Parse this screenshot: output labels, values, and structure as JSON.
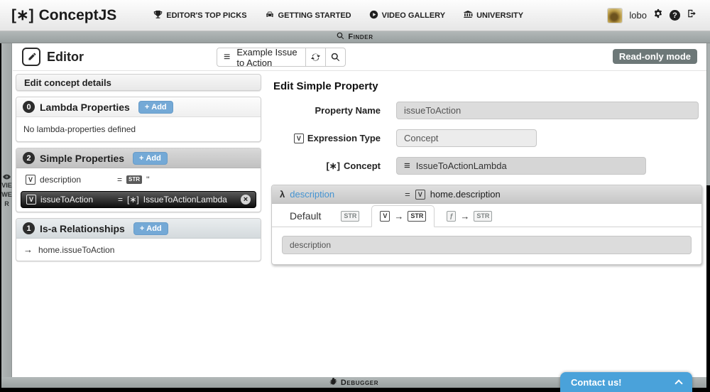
{
  "navbar": {
    "logo_symbol": "[∗]",
    "logo_name": "ConceptJS",
    "items": [
      {
        "label": "EDITOR'S TOP PICKS"
      },
      {
        "label": "GETTING STARTED"
      },
      {
        "label": "VIDEO GALLERY"
      },
      {
        "label": "UNIVERSITY"
      }
    ],
    "username": "lobo"
  },
  "finder_bar": {
    "label": "Finder"
  },
  "toolbar": {
    "editor_title": "Editor",
    "concept_name": "Example Issue to Action",
    "readonly_label": "Read-only mode"
  },
  "viewer_panel": {
    "label": "VIEWER"
  },
  "sidebar": {
    "header": "Edit concept details",
    "lambda": {
      "count": "0",
      "title": "Lambda Properties",
      "add_label": "Add",
      "empty_message": "No lambda-properties defined"
    },
    "simple": {
      "count": "2",
      "title": "Simple Properties",
      "add_label": "Add",
      "rows": [
        {
          "badge": "V",
          "name": "description",
          "eq": "=",
          "type": "STR",
          "value": "''"
        },
        {
          "badge": "V",
          "name": "issueToAction",
          "eq": "=",
          "type": "[∗]",
          "value": "IssueToActionLambda"
        }
      ]
    },
    "isa": {
      "count": "1",
      "title": "Is-a Relationships",
      "add_label": "Add",
      "rows": [
        {
          "value": "home.issueToAction"
        }
      ]
    }
  },
  "editor": {
    "title": "Edit Simple Property",
    "property_name": {
      "label": "Property Name",
      "value": "issueToAction"
    },
    "expression_type": {
      "badge": "V",
      "label": "Expression Type",
      "value": "Concept"
    },
    "concept": {
      "badge": "[∗]",
      "label": "Concept",
      "value": "IssueToActionLambda"
    },
    "expression": {
      "name": "description",
      "eq": "=",
      "badge": "V",
      "binding": "home.description",
      "tabs": {
        "default_label": "Default",
        "str_badge": "STR",
        "v_badge": "V",
        "v_str_badge": "STR",
        "script_str_badge": "STR"
      },
      "value": "description"
    }
  },
  "debugger_bar": {
    "label": "Debugger"
  },
  "contact": {
    "label": "Contact us!"
  },
  "icons": {
    "menu": "≡",
    "lambda": "λ",
    "arrow_right": "→",
    "remove": "×",
    "plus": "+",
    "script": "ƒ"
  },
  "colors": {
    "accent_blue": "#74a9d6",
    "link_blue": "#4493d1",
    "readonly_gray": "#6d7878",
    "contact_blue": "#4aa2da"
  }
}
